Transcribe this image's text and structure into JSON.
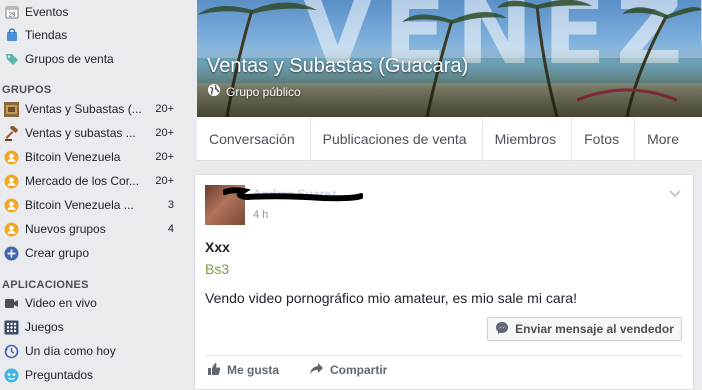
{
  "sidebar": {
    "top_items": [
      {
        "label": "Eventos",
        "icon": "calendar-icon"
      },
      {
        "label": "Tiendas",
        "icon": "shopping-bag-icon"
      },
      {
        "label": "Grupos de venta",
        "icon": "price-tag-icon"
      }
    ],
    "groups_title": "GRUPOS",
    "groups": [
      {
        "label": "Ventas y Subastas (...",
        "count": "20+",
        "icon": "group-thumbnail-icon"
      },
      {
        "label": "Ventas y subastas ...",
        "count": "20+",
        "icon": "gavel-icon"
      },
      {
        "label": "Bitcoin Venezuela",
        "count": "20+",
        "icon": "group-badge-icon"
      },
      {
        "label": "Mercado de los Cor...",
        "count": "20+",
        "icon": "group-badge-icon"
      },
      {
        "label": "Bitcoin Venezuela ...",
        "count": "3",
        "icon": "group-badge-icon"
      },
      {
        "label": "Nuevos grupos",
        "count": "4",
        "icon": "group-badge-icon"
      },
      {
        "label": "Crear grupo",
        "count": "",
        "icon": "plus-circle-icon"
      }
    ],
    "apps_title": "APLICACIONES",
    "apps": [
      {
        "label": "Video en vivo",
        "icon": "live-video-icon"
      },
      {
        "label": "Juegos",
        "icon": "games-grid-icon"
      },
      {
        "label": "Un día como hoy",
        "icon": "clock-history-icon"
      },
      {
        "label": "Preguntados",
        "icon": "trivia-app-icon"
      }
    ]
  },
  "cover": {
    "title": "Ventas y Subastas (Guacara)",
    "privacy": "Grupo público",
    "background_text": "VENEZU"
  },
  "tabs": [
    {
      "label": "Conversación"
    },
    {
      "label": "Publicaciones de venta"
    },
    {
      "label": "Miembros"
    },
    {
      "label": "Fotos"
    },
    {
      "label": "More"
    }
  ],
  "post": {
    "author_redacted": "Andrea Suarez",
    "time": "4 h",
    "item_title": "Xxx",
    "price": "Bs3",
    "description": "Vendo video pornográfico mio amateur, es mio sale mi cara!",
    "seller_button": "Enviar mensaje al vendedor",
    "like_label": "Me gusta",
    "share_label": "Compartir"
  },
  "colors": {
    "background": "#e9ebee",
    "link": "#365899",
    "price_green": "#7a9c42",
    "muted": "#90949c"
  }
}
